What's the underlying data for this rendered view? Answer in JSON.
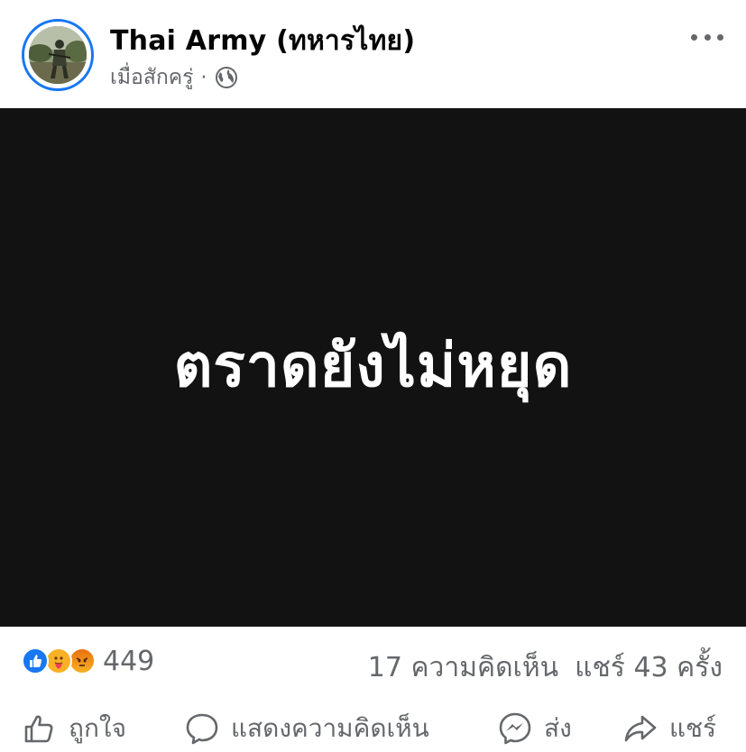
{
  "post": {
    "author": "Thai Army (ทหารไทย)",
    "timestamp": "เมื่อสักครู่",
    "separator": "·",
    "privacy_icon": "globe-icon",
    "more_icon": "more-dots-icon",
    "image_text": "ตราดยังไม่หยุด",
    "image_background": "#121212"
  },
  "stats": {
    "reaction_icons": [
      "like-reaction-icon",
      "care-reaction-icon",
      "angry-reaction-icon"
    ],
    "reaction_count": "449",
    "comments": "17 ความคิดเห็น",
    "shares": "แชร์ 43 ครั้ง"
  },
  "actions": {
    "like": "ถูกใจ",
    "comment": "แสดงความคิดเห็น",
    "send": "ส่ง",
    "share": "แชร์"
  },
  "colors": {
    "accent": "#1877f2",
    "secondary_text": "#65676b"
  }
}
